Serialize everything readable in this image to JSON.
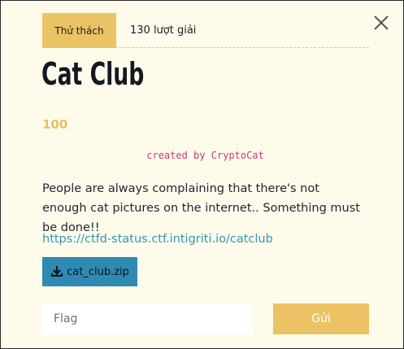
{
  "tabs": {
    "challenge_label": "Thử thách",
    "solves_label": "130 lượt giải"
  },
  "close_icon": "close-icon",
  "challenge": {
    "title": "Cat Club",
    "points": "100",
    "author": "created by CryptoCat",
    "description": "People are always complaining that there's not enough cat pictures on the internet.. Something must be done!!",
    "link": "https://ctfd-status.ctf.intigriti.io/catclub",
    "file_label": "cat_club.zip",
    "file_icon": "download-icon"
  },
  "form": {
    "flag_placeholder": "Flag",
    "flag_value": "",
    "submit_label": "Gửi"
  },
  "colors": {
    "accent": "#ebc364",
    "background": "#fffbeb",
    "link": "#2e96b6",
    "file_button": "#2e8ab3",
    "author": "#d0367a"
  }
}
